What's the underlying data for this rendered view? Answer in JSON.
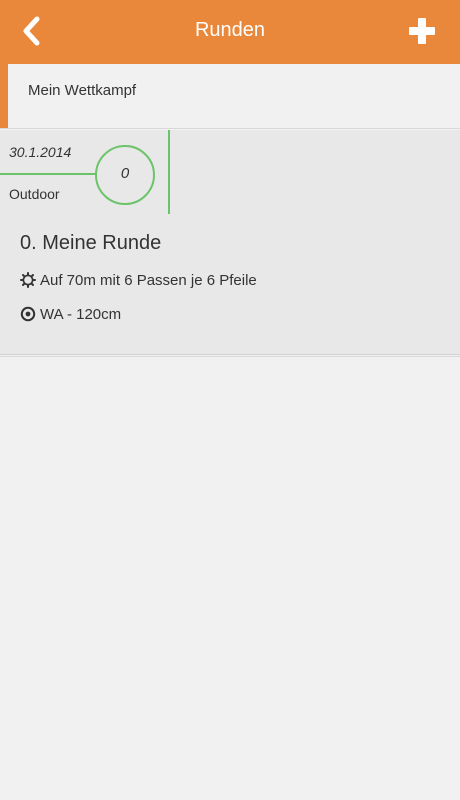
{
  "header": {
    "title": "Runden",
    "back_icon": "chevron-left-icon",
    "add_icon": "plus-icon",
    "background_color": "#e9883a"
  },
  "group": {
    "title": "Mein Wettkampf",
    "accent_color": "#e9883a"
  },
  "round": {
    "date": "30.1.2014",
    "environment": "Outdoor",
    "score": "0",
    "name": "0. Meine Runde",
    "distance_text": "Auf 70m mit 6 Passen je 6 Pfeile",
    "distance_icon": "gear-icon",
    "target_text": "WA - 120cm",
    "target_icon": "target-icon",
    "indicator_color": "#6cc46a"
  }
}
